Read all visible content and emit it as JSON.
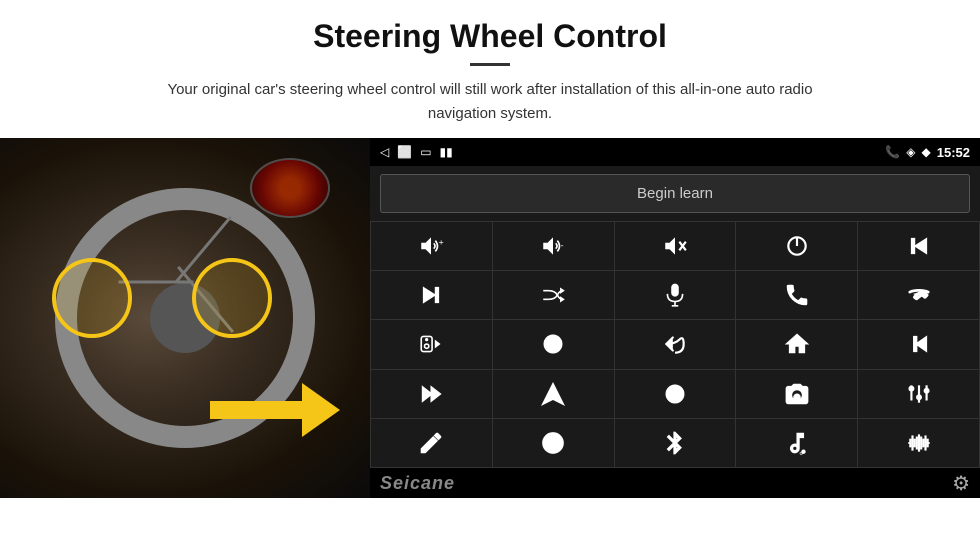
{
  "header": {
    "title": "Steering Wheel Control",
    "subtitle": "Your original car's steering wheel control will still work after installation of this all-in-one auto radio navigation system.",
    "divider": true
  },
  "status_bar": {
    "time": "15:52",
    "back_icon": "◁",
    "window_icon": "⬜",
    "square_icon": "▭",
    "signal_icon": "▮▮",
    "phone_icon": "📞",
    "location_icon": "◈",
    "wifi_icon": "◆"
  },
  "begin_learn": {
    "label": "Begin learn"
  },
  "icon_grid": {
    "rows": [
      [
        "vol+",
        "vol-",
        "mute",
        "power",
        "prev-track"
      ],
      [
        "skip-fwd",
        "shuffle-fwd",
        "mic",
        "phone",
        "hang-up"
      ],
      [
        "speaker",
        "360-view",
        "back",
        "home",
        "skip-back"
      ],
      [
        "fast-fwd",
        "navigate",
        "eq",
        "camera",
        "eq-sliders"
      ],
      [
        "pen",
        "circle",
        "bluetooth",
        "music-settings",
        "waveform"
      ]
    ]
  },
  "bottom_bar": {
    "logo": "Seicane",
    "gear_label": "⚙"
  },
  "colors": {
    "background": "#1a1a1a",
    "accent": "#f5c518",
    "text": "#ccc",
    "border": "#555"
  }
}
